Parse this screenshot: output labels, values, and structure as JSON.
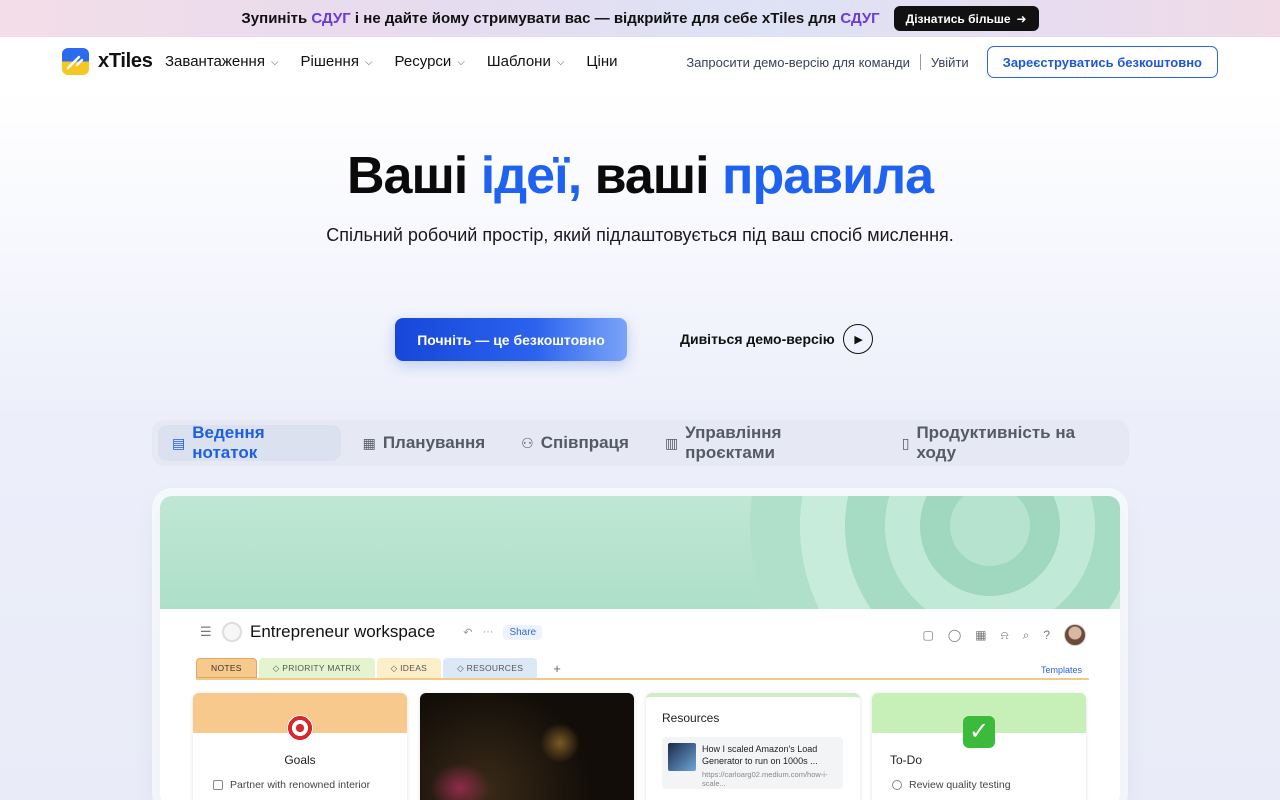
{
  "promo": {
    "text_1": "Зупиніть",
    "hl_1": "СДУГ",
    "text_2": "і не дайте йому стримувати вас — відкрийте для себе xTiles для",
    "hl_2": "СДУГ",
    "button": "Дізнатись більше"
  },
  "nav": {
    "logo_text": "xTiles",
    "menu": [
      {
        "label": "Завантаження",
        "has_dropdown": true
      },
      {
        "label": "Рішення",
        "has_dropdown": true
      },
      {
        "label": "Ресурси",
        "has_dropdown": true
      },
      {
        "label": "Шаблони",
        "has_dropdown": true
      },
      {
        "label": "Ціни",
        "has_dropdown": false
      }
    ],
    "demo_link": "Запросити демо-версію для команди",
    "login": "Увійти",
    "signup": "Зареєструватись безкоштовно"
  },
  "hero": {
    "title_1": "Ваші",
    "title_2": "ідеї,",
    "title_3": "ваші",
    "title_4": "правила",
    "subtitle": "Спільний робочий простір, який підлаштовується під ваш спосіб мислення.",
    "cta": "Почніть — це безкоштовно",
    "watch_demo": "Дивіться демо-версію"
  },
  "tabs": [
    {
      "label": "Ведення нотаток",
      "icon": "notes-icon",
      "active": true
    },
    {
      "label": "Планування",
      "icon": "calendar-icon",
      "active": false
    },
    {
      "label": "Співпраця",
      "icon": "team-icon",
      "active": false
    },
    {
      "label": "Управління проєктами",
      "icon": "document-icon",
      "active": false
    },
    {
      "label": "Продуктивність на ходу",
      "icon": "phone-icon",
      "active": false
    }
  ],
  "preview": {
    "workspace_title": "Entrepreneur workspace",
    "share": "Share",
    "page_tabs": [
      "NOTES",
      "PRIORITY MATRIX",
      "IDEAS",
      "RESOURCES"
    ],
    "templates": "Templates",
    "goals_title": "Goals",
    "goals_item": "Partner with renowned interior",
    "resources_title": "Resources",
    "resource_item_title": "How I scaled Amazon's Load Generator to run on 1000s ...",
    "resource_item_url": "https://carloarg02.medium.com/how-i-scale...",
    "todo_title": "To-Do",
    "todo_item": "Review quality testing"
  },
  "colors": {
    "accent": "#1f62f0",
    "promo_highlight": "#6a3bd6"
  }
}
